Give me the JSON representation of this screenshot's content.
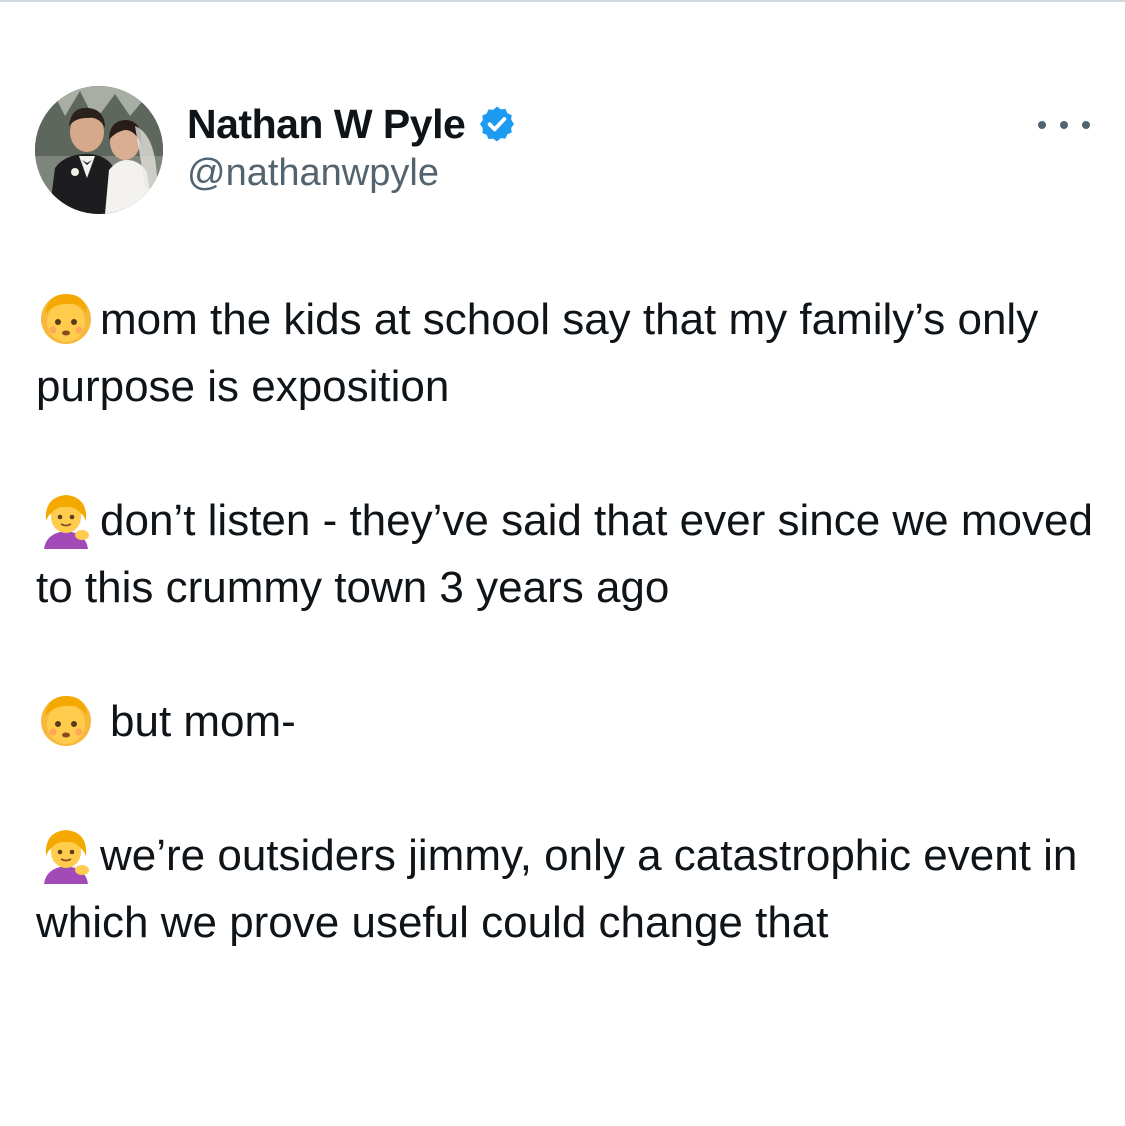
{
  "tweet": {
    "author": {
      "display_name": "Nathan W Pyle",
      "handle": "@nathanwpyle",
      "verified": true,
      "avatar_icon": "wedding-photo-avatar"
    },
    "more_icon": "more-options-icon",
    "colors": {
      "verified_badge": "#1d9bf0",
      "text": "#0f1419",
      "secondary_text": "#536471"
    },
    "lines": [
      {
        "speaker_icon": "child-emoji-icon",
        "text": "mom the kids at school say that my family’s only purpose is exposition"
      },
      {
        "speaker_icon": "woman-tipping-hand-emoji-icon",
        "text": "don’t listen - they’ve said that ever since we moved to this crummy town 3 years ago"
      },
      {
        "speaker_icon": "child-emoji-icon",
        "text": "but mom-"
      },
      {
        "speaker_icon": "woman-tipping-hand-emoji-icon",
        "text": "we’re outsiders jimmy, only a catastrophic event in which we prove useful could change that"
      }
    ]
  }
}
